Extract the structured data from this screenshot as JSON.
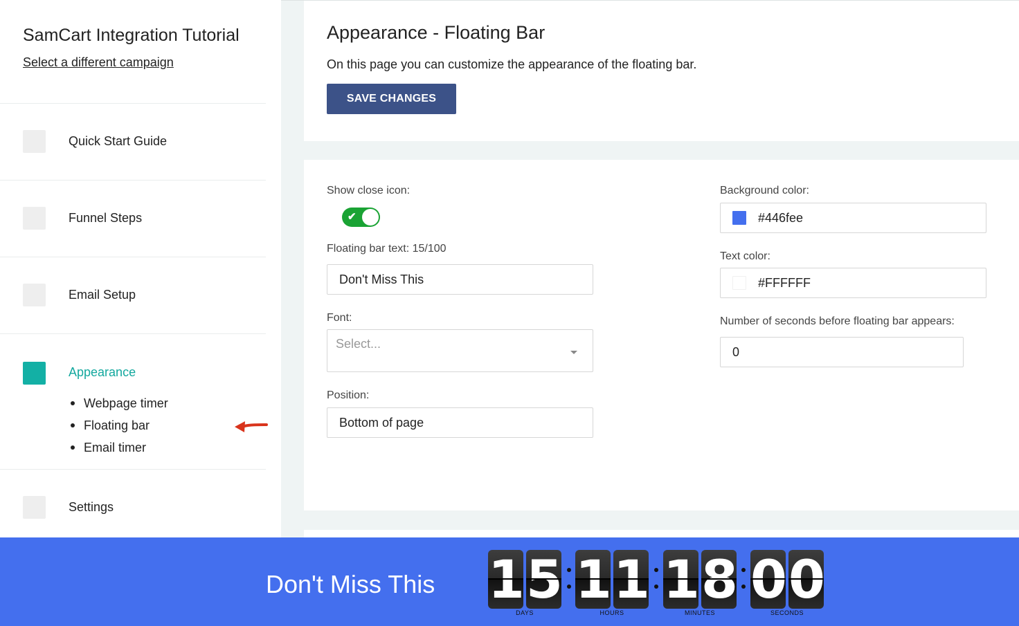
{
  "sidebar": {
    "campaign_title": "SamCart Integration Tutorial",
    "change_campaign_link": "Select a different campaign",
    "items": [
      {
        "label": "Quick Start Guide"
      },
      {
        "label": "Funnel Steps"
      },
      {
        "label": "Email Setup"
      },
      {
        "label": "Appearance",
        "active": true,
        "sub_items": [
          "Webpage timer",
          "Floating bar",
          "Email timer"
        ]
      },
      {
        "label": "Settings"
      }
    ],
    "accent_color": "#13b0a5"
  },
  "header": {
    "title": "Appearance - Floating Bar",
    "description": "On this page you can customize the appearance of the floating bar.",
    "save_label": "SAVE CHANGES"
  },
  "form": {
    "close_icon_label": "Show close icon:",
    "close_icon_enabled": true,
    "floating_text_label": "Floating bar text: 15/100",
    "floating_text_value": "Don't Miss This",
    "font_label": "Font:",
    "font_placeholder": "Select...",
    "position_label": "Position:",
    "position_value": "Bottom of page",
    "bg_color_label": "Background color:",
    "bg_color_value": "#446fee",
    "text_color_label": "Text color:",
    "text_color_value": "#FFFFFF",
    "seconds_label": "Number of seconds before floating bar appears:",
    "seconds_value": "0"
  },
  "floating_bar": {
    "text": "Don't Miss This",
    "background": "#446fee",
    "timer": {
      "days": "15",
      "hours": "11",
      "minutes": "18",
      "seconds": "00",
      "days_label": "DAYS",
      "hours_label": "HOURS",
      "minutes_label": "MINUTES",
      "seconds_label": "SECONDS"
    }
  }
}
